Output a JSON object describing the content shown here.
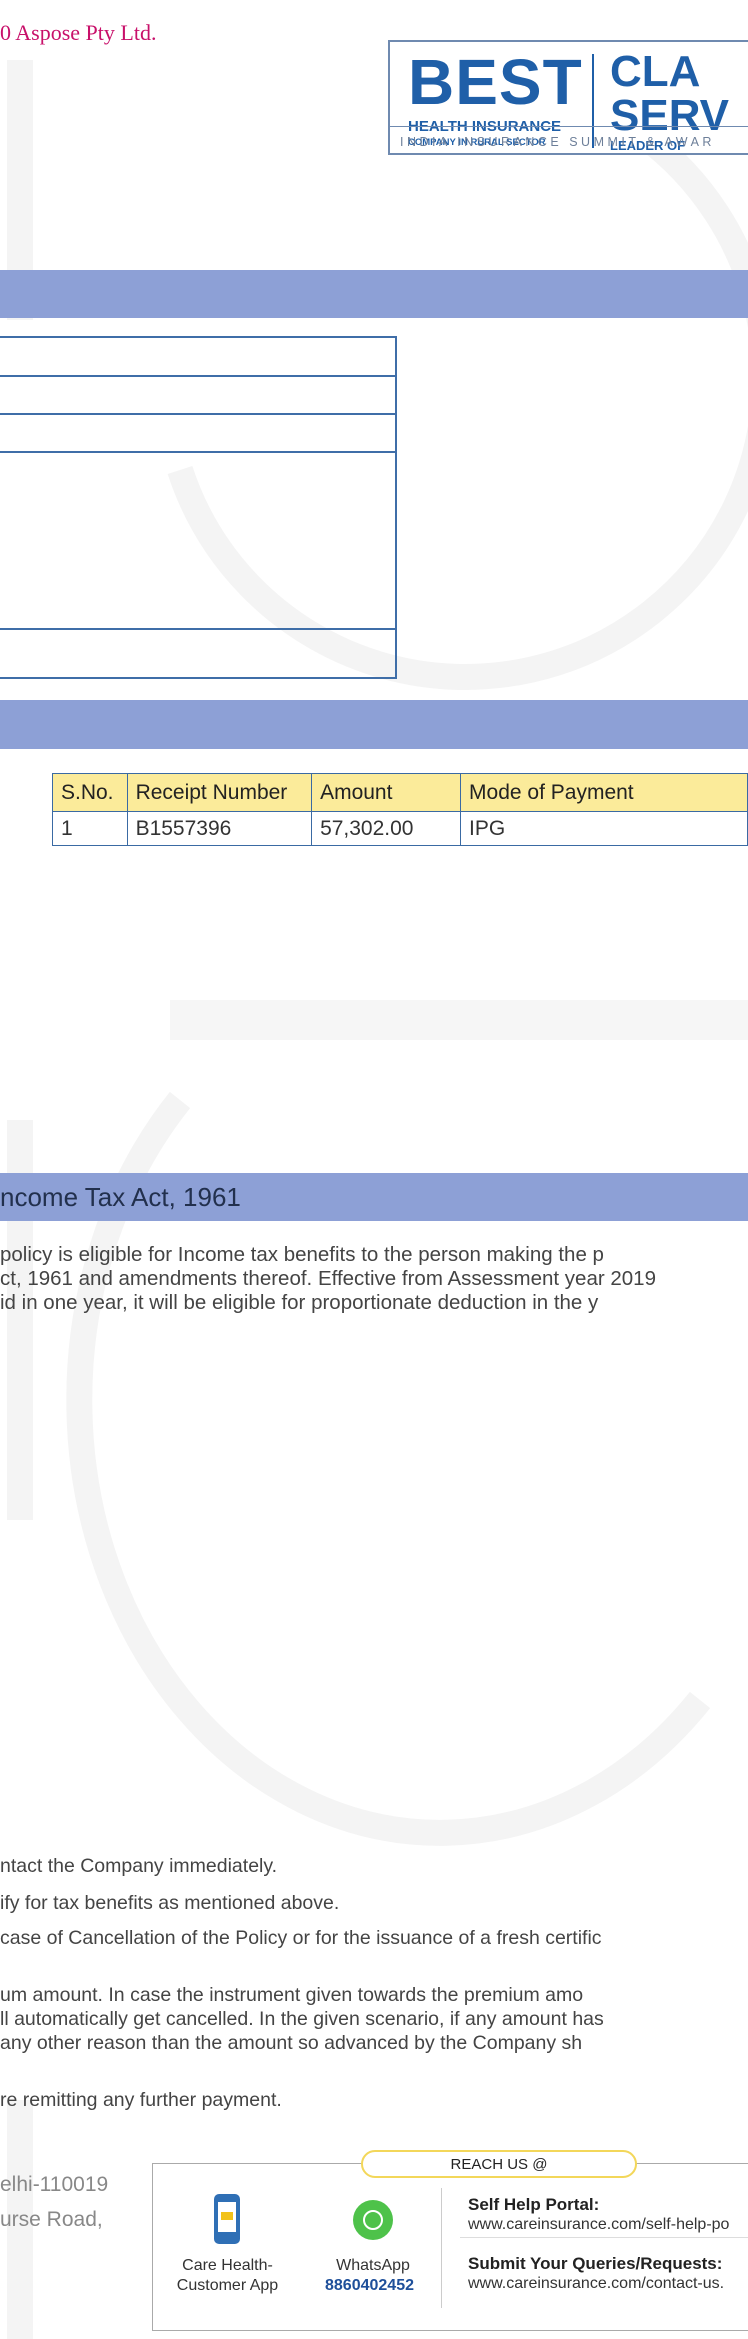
{
  "header": {
    "evaluation_notice": "0 Aspose Pty Ltd."
  },
  "award_logo": {
    "best": "BEST",
    "health_insurance": "HEALTH INSURANCE",
    "company_rural": "COMPANY IN RURAL SECTOR",
    "cla": "CLA",
    "serv": "SERV",
    "leader": "LEADER OF",
    "summit": "INDIA INSURANCE SUMMIT & AWAR"
  },
  "receipts": {
    "columns": [
      "S.No.",
      "Receipt Number",
      "Amount",
      "Mode of Payment"
    ],
    "rows": [
      [
        "1",
        "B1557396",
        "57,302.00",
        "IPG"
      ]
    ]
  },
  "tax_section": {
    "title": "ncome Tax Act, 1961",
    "lines": [
      " policy is eligible for Income tax benefits to the person making the p",
      "ct, 1961 and amendments thereof. Effective from Assessment year 2019",
      "id in one year, it will be eligible for proportionate deduction in the y"
    ]
  },
  "notes": {
    "lines": [
      "ntact the Company immediately.",
      "ify for tax benefits as mentioned above.",
      "case of Cancellation of the Policy or for the issuance of a fresh certific",
      "um amount. In case the instrument given towards the premium amo",
      "ll automatically get cancelled. In the given scenario, if any amount has",
      "any other reason than the amount so advanced by the Company sh",
      "re remitting any further payment."
    ]
  },
  "address": {
    "line1": "elhi-110019",
    "line2": "urse Road,"
  },
  "reach_us": {
    "title": "REACH US @",
    "app_label_1": "Care Health-",
    "app_label_2": "Customer App",
    "whatsapp_label": "WhatsApp",
    "whatsapp_number": "8860402452",
    "self_help_title": "Self Help Portal:",
    "self_help_url": "www.careinsurance.com/self-help-po",
    "queries_title": "Submit Your Queries/Requests:",
    "queries_url": "www.careinsurance.com/contact-us."
  },
  "colors": {
    "band": "#8da0d6",
    "table_header": "#fbeb9a",
    "brand_blue": "#1f5fa8",
    "evaluation_text": "#c8106a"
  }
}
